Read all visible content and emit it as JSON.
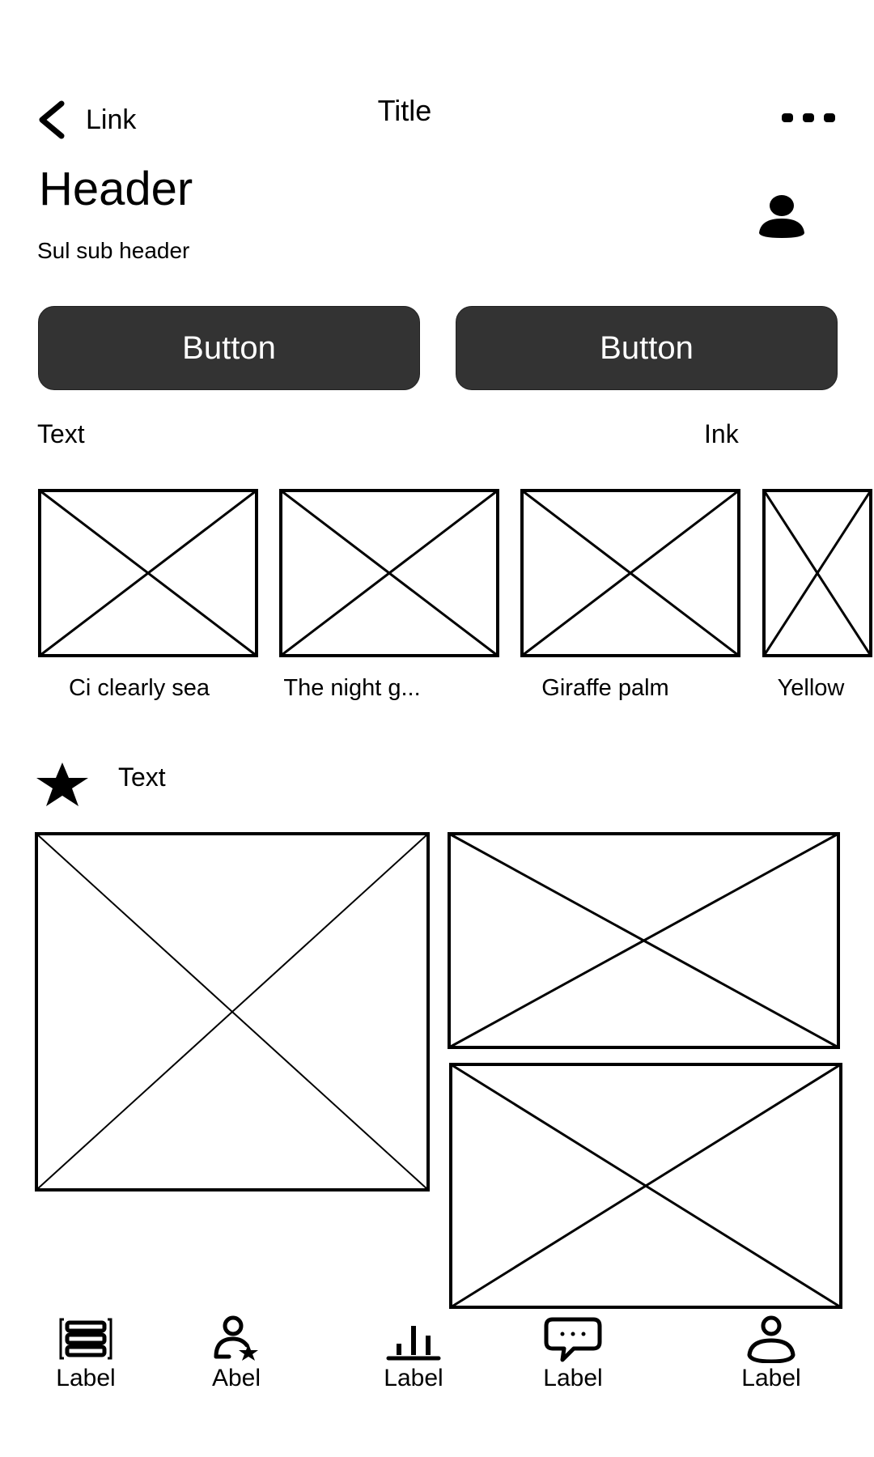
{
  "topbar": {
    "back_label": "Link",
    "title": "Title"
  },
  "header": {
    "title": "Header",
    "subheader": "Sul sub header"
  },
  "buttons": [
    {
      "label": "Button"
    },
    {
      "label": "Button"
    }
  ],
  "section1": {
    "left_text": "Text",
    "right_link": "Ink"
  },
  "carousel": [
    {
      "caption": "Ci clearly sea"
    },
    {
      "caption": "The night g..."
    },
    {
      "caption": "Giraffe palm"
    },
    {
      "caption": "Yellow"
    }
  ],
  "section2": {
    "icon": "star-icon",
    "text": "Text"
  },
  "bottom_nav": [
    {
      "label": "Label",
      "icon": "stack-icon"
    },
    {
      "label": "Abel",
      "icon": "user-star-icon"
    },
    {
      "label": "Label",
      "icon": "bar-chart-icon"
    },
    {
      "label": "Label",
      "icon": "chat-icon"
    },
    {
      "label": "Label",
      "icon": "profile-icon"
    }
  ]
}
